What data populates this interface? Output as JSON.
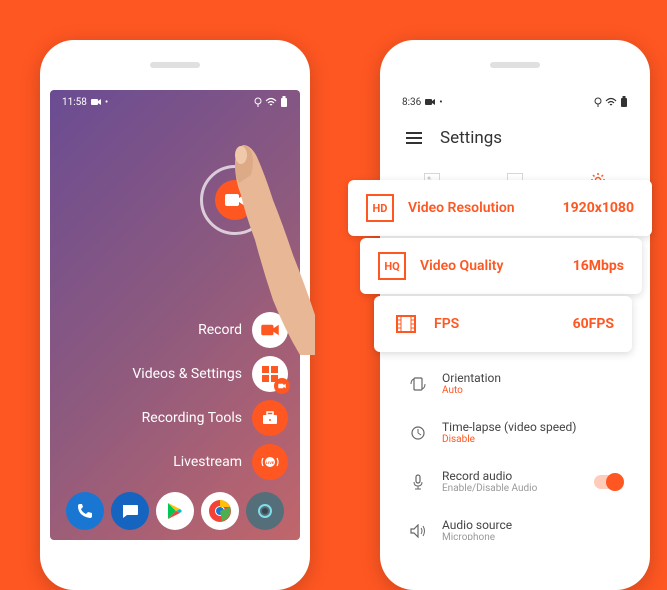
{
  "left_phone": {
    "time": "11:58",
    "menu": {
      "record": "Record",
      "videos_settings": "Videos & Settings",
      "tools": "Recording Tools",
      "livestream": "Livestream"
    }
  },
  "right_phone": {
    "time": "8:36",
    "title": "Settings",
    "cards": {
      "resolution": {
        "label": "Video Resolution",
        "value": "1920x1080",
        "icon": "HD"
      },
      "quality": {
        "label": "Video Quality",
        "value": "16Mbps",
        "icon": "HQ"
      },
      "fps": {
        "label": "FPS",
        "value": "60FPS"
      }
    },
    "settings": {
      "orientation": {
        "label": "Orientation",
        "value": "Auto"
      },
      "timelapse": {
        "label": "Time-lapse (video speed)",
        "value": "Disable"
      },
      "audio": {
        "label": "Record audio",
        "sub": "Enable/Disable Audio"
      },
      "source": {
        "label": "Audio source",
        "sub": "Microphone"
      }
    }
  }
}
